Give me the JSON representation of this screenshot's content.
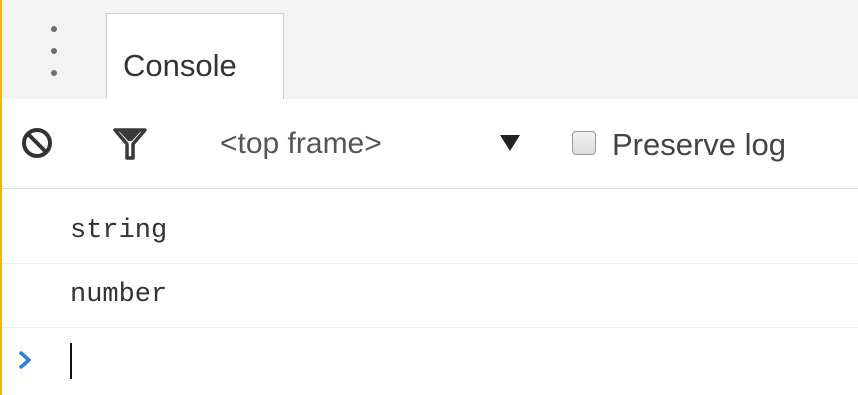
{
  "tabs": [
    {
      "label": "Console"
    }
  ],
  "toolbar": {
    "context_selector": "<top frame>",
    "preserve_log_label": "Preserve log",
    "preserve_log_checked": false
  },
  "console": {
    "messages": [
      {
        "text": "string"
      },
      {
        "text": "number"
      }
    ],
    "prompt_value": ""
  },
  "colors": {
    "accent_border": "#f5b400",
    "prompt_chevron": "#2f7fd7"
  },
  "icons": [
    "more-vertical-icon",
    "clear-console-icon",
    "filter-icon",
    "dropdown-arrow-icon",
    "prompt-chevron-icon"
  ]
}
